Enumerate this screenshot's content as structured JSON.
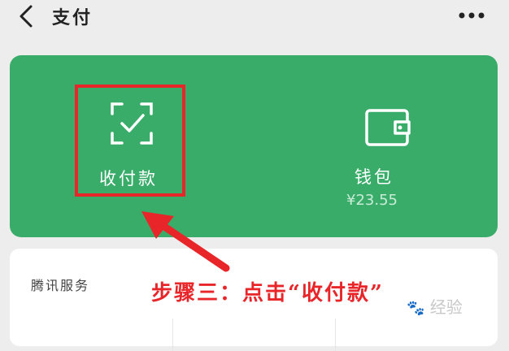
{
  "header": {
    "title": "支付",
    "back_icon": "chevron-left-icon",
    "more_icon": "more-dots-icon"
  },
  "pay_card": {
    "background": "#3aac6a",
    "receive_pay": {
      "label": "收付款",
      "icon": "scan-check-icon"
    },
    "wallet": {
      "label": "钱包",
      "balance": "¥23.55",
      "icon": "wallet-icon"
    }
  },
  "services": {
    "title": "腾讯服务"
  },
  "annotation": {
    "step_text": "步骤三：点击“收付款”",
    "color": "#e8262a"
  },
  "watermark": {
    "text": "经验"
  }
}
